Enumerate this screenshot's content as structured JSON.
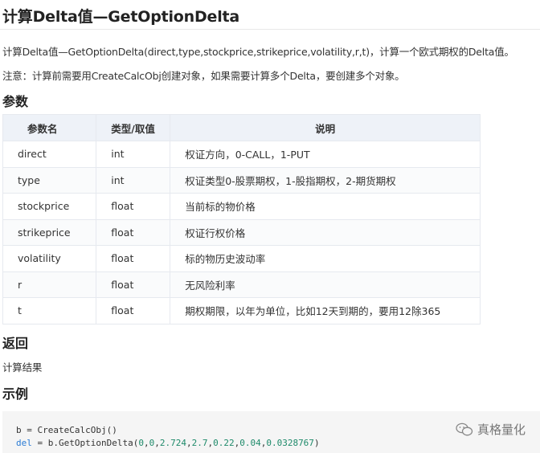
{
  "title": "计算Delta值—GetOptionDelta",
  "description": "计算Delta值—GetOptionDelta(direct,type,stockprice,strikeprice,volatility,r,t)，计算一个欧式期权的Delta值。",
  "note": "注意：计算前需要用CreateCalcObj创建对象，如果需要计算多个Delta，要创建多个对象。",
  "params_heading": "参数",
  "table": {
    "headers": [
      "参数名",
      "类型/取值",
      "说明"
    ],
    "rows": [
      [
        "direct",
        "int",
        "权证方向，0-CALL，1-PUT"
      ],
      [
        "type",
        "int",
        "权证类型0-股票期权，1-股指期权，2-期货期权"
      ],
      [
        "stockprice",
        "float",
        "当前标的物价格"
      ],
      [
        "strikeprice",
        "float",
        "权证行权价格"
      ],
      [
        "volatility",
        "float",
        "标的物历史波动率"
      ],
      [
        "r",
        "float",
        "无风险利率"
      ],
      [
        "t",
        "float",
        "期权期限，以年为单位，比如12天到期的，要用12除365"
      ]
    ]
  },
  "return_heading": "返回",
  "return_text": "计算结果",
  "example_heading": "示例",
  "code": {
    "line1": "b = CreateCalcObj()",
    "line2_var": "del",
    "line2_mid": " = b.GetOptionDelta(",
    "args": [
      "0",
      "0",
      "2.724",
      "2.7",
      "0.22",
      "0.04",
      "0.0328767"
    ],
    "line2_end": ")"
  },
  "watermark": "真格量化"
}
